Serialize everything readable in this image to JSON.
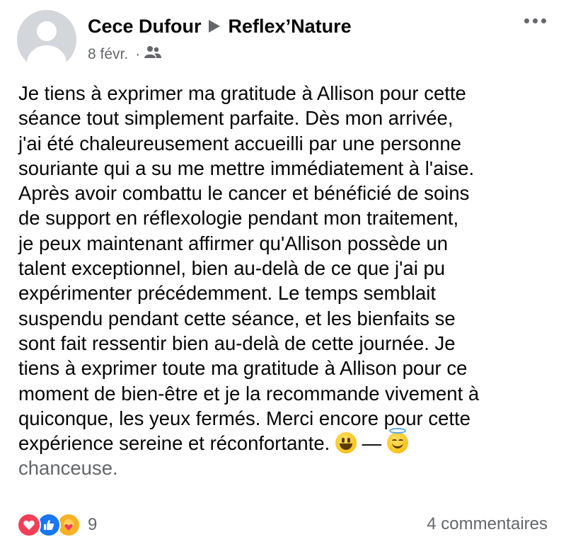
{
  "post": {
    "author": "Cece Dufour",
    "target_page": "Reflex’Nature",
    "date": "8 févr.",
    "audience_icon": "friends-icon",
    "more_icon": "more-options-icon"
  },
  "body": {
    "lines": [
      "Je tiens à exprimer ma gratitude à Allison pour cette",
      "séance tout simplement parfaite. Dès mon arrivée,",
      "j'ai été chaleureusement accueilli par une personne",
      "souriante qui a su me mettre immédiatement à l'aise.",
      "Après avoir combattu le cancer et bénéficié de soins",
      "de support en réflexologie pendant mon traitement,",
      "je peux maintenant affirmer qu'Allison possède un",
      "talent exceptionnel, bien au-delà de ce que j'ai pu",
      "expérimenter précédemment. Le temps semblait",
      "suspendu pendant cette séance, et les bienfaits se",
      "sont fait ressentir bien au-delà de cette journée. Je",
      "tiens à exprimer toute ma gratitude à Allison pour ce",
      "moment de bien-être et je la recommande vivement à",
      "quiconque, les yeux fermés. Merci encore pour cette"
    ],
    "last_line": "expérience sereine et réconfortante.",
    "dash": "—",
    "feeling": "chanceuse.",
    "emojis": [
      "grinning-face-emoji",
      "smiling-face-with-halo-emoji"
    ]
  },
  "footer": {
    "reactions": [
      "love-reaction-icon",
      "like-reaction-icon",
      "care-reaction-icon"
    ],
    "reaction_count": "9",
    "comments": "4 commentaires"
  }
}
